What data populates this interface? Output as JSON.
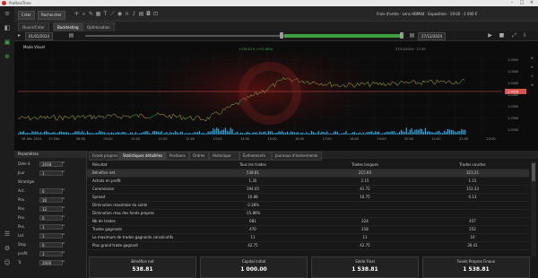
{
  "window": {
    "title": "ProRealTime"
  },
  "toolbar": {
    "left_button": "Créer",
    "search_button": "Rechercher",
    "status_text": "Frais d'ordre · Lens HBM84 · Exposition · 19:00 · 1 000 €"
  },
  "tabs": [
    {
      "label": "Ouvrir/Créer",
      "active": false
    },
    {
      "label": "Backtesting",
      "active": true
    },
    {
      "label": "Optimisation",
      "active": false
    }
  ],
  "dates": {
    "start": "01/01/2024",
    "end": "27/12/2024"
  },
  "range": {
    "start_fraction": 0.84,
    "end_fraction": 1.0
  },
  "chart": {
    "mode_label": "Mode Visuel",
    "top_annotation": "+538.81 € (+53.88%)",
    "date_bubble": "27/12/2024 · 17:30",
    "y_ticks": [
      "1.0550",
      "1.0500",
      "1.0450",
      "1.0400",
      "1.0350",
      "1.0300",
      "1.0250"
    ],
    "current_price": "1.0416",
    "x_ticks": [
      "26 Déc 2024",
      "27 Déc",
      "08:00",
      "09:00",
      "10:00",
      "11:00",
      "12:00",
      "13:00",
      "14:00",
      "15:00",
      "16:00",
      "17:00",
      "18:00",
      "19:00",
      "20:00",
      "21:00",
      "22:00",
      "23:00"
    ],
    "colors": {
      "up": "#3fa34d",
      "down": "#e07b2c",
      "volume": "#35a7e0",
      "price_line": "#d9534f"
    }
  },
  "params": {
    "header": "Paramètres",
    "rows": [
      {
        "label": "Date d.",
        "value": "2018"
      },
      {
        "label": "Jour",
        "value": "1"
      },
      {
        "label": "Stratégie",
        "value": ""
      },
      {
        "label": "Act.",
        "value": "0"
      },
      {
        "label": "Pos.",
        "value": "10"
      },
      {
        "label": "Pos.",
        "value": "12"
      },
      {
        "label": "Pos.",
        "value": "0"
      },
      {
        "label": "Pos.",
        "value": "1"
      },
      {
        "label": "Lot",
        "value": "1"
      },
      {
        "label": "Stop",
        "value": "0"
      },
      {
        "label": "profit",
        "value": "1"
      },
      {
        "label": "Tr.",
        "value": "2000"
      }
    ]
  },
  "results": {
    "tabs": [
      {
        "label": "Fonds propres",
        "active": false
      },
      {
        "label": "Statistiques détaillées",
        "active": true
      },
      {
        "label": "Positions",
        "active": false
      },
      {
        "label": "Ordres",
        "active": false
      },
      {
        "label": "Historique",
        "active": false
      },
      {
        "label": "Événements",
        "active": false
      },
      {
        "label": "Journaux d'événements",
        "active": false
      }
    ],
    "columns": [
      "Résultat",
      "Tous les trades",
      "Trades longues",
      "Trades courtes"
    ],
    "rows": [
      {
        "label": "Bénéfice net",
        "all": "538.81",
        "long": "215.60",
        "short": "323.21",
        "highlight": true
      },
      {
        "label": "Achats en profit",
        "all": "1.35",
        "long": "2.15",
        "short": "1.15"
      },
      {
        "label": "Commission",
        "all": "194.05",
        "long": "41.72",
        "short": "152.33"
      },
      {
        "label": "Spread",
        "all": "10.88",
        "long": "10.75",
        "short": "0.13"
      },
      {
        "label": "Diminution maximale du solde",
        "all": "-2.28%",
        "long": "",
        "short": ""
      },
      {
        "label": "Diminution max des fonds propres",
        "all": "-15.86%",
        "long": "",
        "short": ""
      },
      {
        "label": "Nb de trades",
        "all": "681",
        "long": "224",
        "short": "457"
      },
      {
        "label": "Trades gagnants",
        "all": "470",
        "long": "218",
        "short": "252"
      },
      {
        "label": "Le maximum de trades gagnants consécutifs",
        "all": "11",
        "long": "11",
        "short": "10"
      },
      {
        "label": "Plus grand trade gagnant",
        "all": "42.75",
        "long": "42.75",
        "short": "30.41"
      }
    ],
    "cards": [
      {
        "label": "Bénéfice net",
        "value": "538.81"
      },
      {
        "label": "Capital initial",
        "value": "1 000.00"
      },
      {
        "label": "Solde Final",
        "value": "1 538.81"
      },
      {
        "label": "Fonds Propres Finaux",
        "value": "1 538.81"
      }
    ]
  }
}
